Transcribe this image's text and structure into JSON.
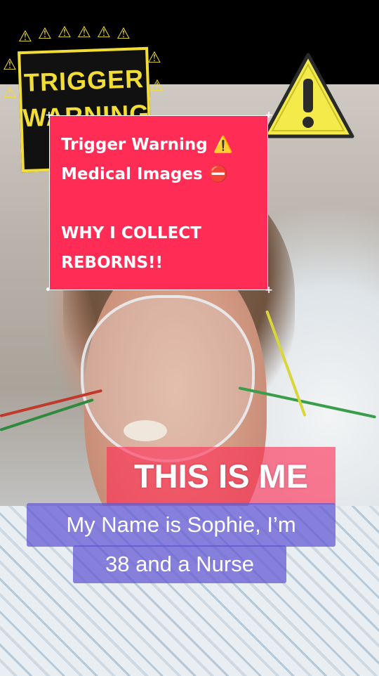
{
  "warning_sign": {
    "line1": "TRIGGER",
    "line2": "WARNING",
    "icon": "warning-triangle-icon",
    "color": "#f1dd35"
  },
  "caption_card": {
    "lines": [
      "Trigger Warning ⚠️",
      "Medical Images ⛔",
      "",
      "WHY I COLLECT",
      "REBORNS!!"
    ],
    "background": "#ff2d55"
  },
  "this_is_me": "THIS IS ME",
  "intro": {
    "line1": "My Name is Sophie, I’m",
    "line2": "38 and a Nurse"
  },
  "colors": {
    "accent_pink": "#ff2d55",
    "caption_purple": "#5f55d2",
    "warning_yellow": "#f1dd35"
  }
}
